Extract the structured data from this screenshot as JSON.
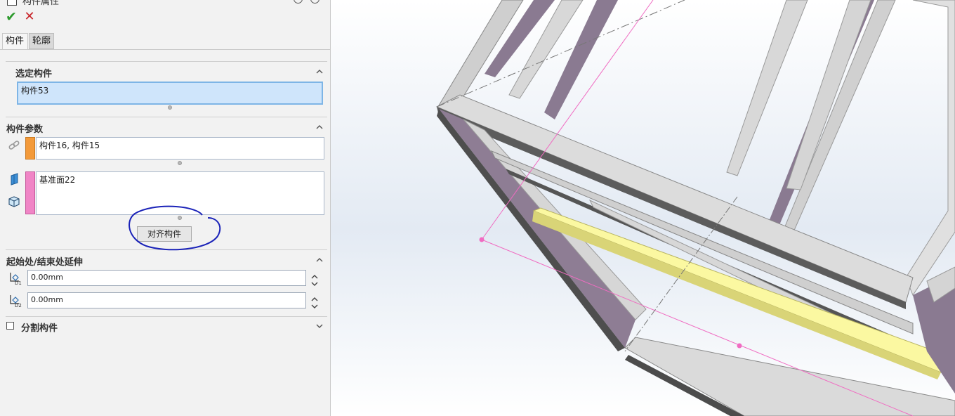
{
  "header": {
    "title": "构件属性"
  },
  "tabs": [
    {
      "label": "构件"
    },
    {
      "label": "轮廓"
    }
  ],
  "selected_member": {
    "title": "选定构件",
    "value": "构件53"
  },
  "member_params": {
    "title": "构件参数",
    "box1_value": "构件16, 构件15",
    "box2_value": "基准面22",
    "align_button": "对齐构件"
  },
  "extension": {
    "title": "起始处/结束处延伸",
    "d1_value": "0.00mm",
    "d2_value": "0.00mm"
  },
  "split": {
    "label": "分割构件",
    "checked": false
  },
  "colors": {
    "ok": "#2d9a2d",
    "cancel": "#c8262b",
    "strip_orange": "#f39a3a",
    "strip_pink": "#f085c6",
    "selection_blue": "#cfe5fb",
    "highlight_beam": "#fbf8a1",
    "annotation_ink": "#1a22b8"
  },
  "icons": {
    "ok": "check-icon",
    "cancel": "close-icon",
    "link": "link-icon",
    "plane": "plane-icon",
    "solid": "solid-body-icon",
    "d1": "dimension-d1-icon",
    "d2": "dimension-d2-icon"
  }
}
